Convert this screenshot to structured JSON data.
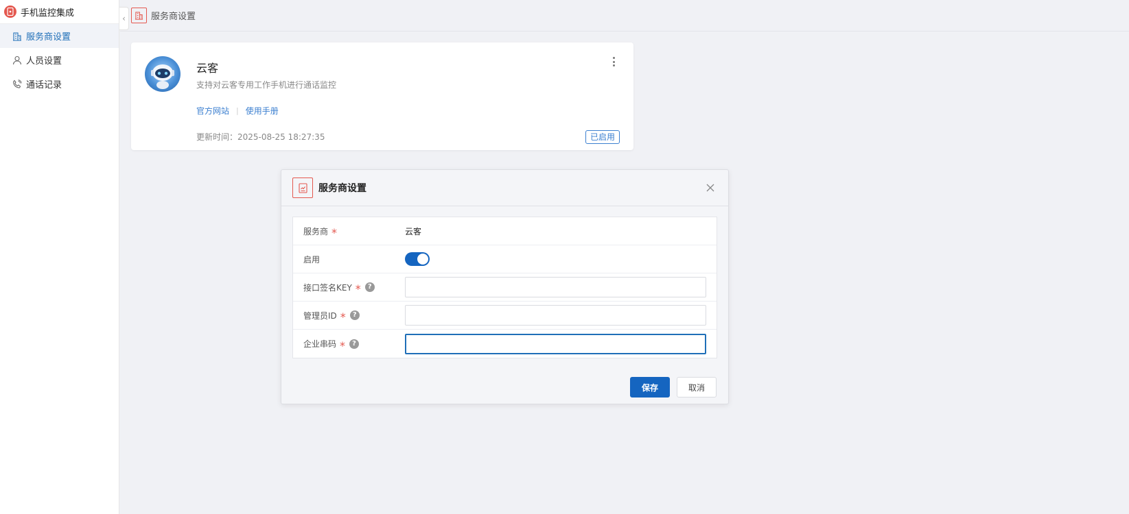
{
  "app": {
    "title": "手机监控集成"
  },
  "sidebar": {
    "items": [
      {
        "label": "服务商设置",
        "icon": "building-icon",
        "active": true
      },
      {
        "label": "人员设置",
        "icon": "user-icon",
        "active": false
      },
      {
        "label": "通话记录",
        "icon": "phone-icon",
        "active": false
      }
    ]
  },
  "topbar": {
    "title": "服务商设置"
  },
  "provider_card": {
    "name": "云客",
    "description": "支持对云客专用工作手机进行通话监控",
    "links": {
      "website": "官方网站",
      "manual": "使用手册",
      "separator": "|"
    },
    "update_time": "更新时间：2025-08-25 18:27:35",
    "status": "已启用"
  },
  "dialog": {
    "title": "服务商设置",
    "fields": {
      "provider": {
        "label": "服务商",
        "value": "云客"
      },
      "enabled": {
        "label": "启用",
        "value": true
      },
      "key": {
        "label": "接口签名KEY",
        "value": ""
      },
      "admin_id": {
        "label": "管理员ID",
        "value": ""
      },
      "company_code": {
        "label": "企业串码",
        "value": ""
      }
    },
    "required_mark": "*",
    "help_mark": "?",
    "save_label": "保存",
    "cancel_label": "取消"
  },
  "colors": {
    "accent": "#1565c0",
    "brand_red": "#e4584f",
    "link": "#3b7fd0"
  }
}
